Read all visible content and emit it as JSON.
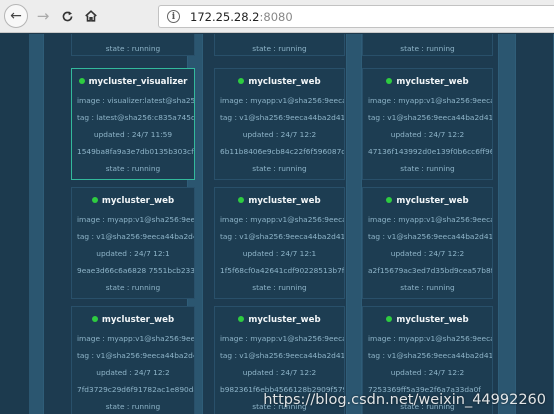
{
  "browser": {
    "url_host": "172.25.28.2",
    "url_port": ":8080",
    "back_icon": "arrow-left-icon",
    "forward_icon": "arrow-right-icon",
    "reload_icon": "reload-icon",
    "home_icon": "home-icon",
    "info_glyph": "i"
  },
  "top_partial": [
    {
      "text": "state : running"
    },
    {
      "text": "state : running"
    },
    {
      "text": "state : running"
    }
  ],
  "rows": [
    [
      {
        "name": "mycluster_visualizer",
        "image": "image : visualizer:latest@sha256:c",
        "tag": "tag : latest@sha256:c835a745d99e",
        "updated": "updated : 24/7 11:59",
        "id": "1549ba8fa9a3e7db0135b303cf96a",
        "state": "state : running"
      },
      {
        "name": "mycluster_web",
        "image": "image : myapp:v1@sha256:9eeca4e",
        "tag": "tag : v1@sha256:9eeca44ba2d410e",
        "updated": "updated : 24/7 12:2",
        "id": "6b11b8406e9cb84c22f6f596087ca",
        "state": "state : running"
      },
      {
        "name": "mycluster_web",
        "image": "image : myapp:v1@sha256:9eeca4e",
        "tag": "tag : v1@sha256:9eeca44ba2d410e",
        "updated": "updated : 24/7 12:2",
        "id": "47136f143992d0e139f0b6cc6ff961",
        "state": "state : running"
      }
    ],
    [
      {
        "name": "mycluster_web",
        "image": "image : myapp:v1@sha256:9eeca4e",
        "tag": "tag : v1@sha256:9eeca44ba2d410e",
        "updated": "updated : 24/7 12:1",
        "id": "9eae3d66c6a6828 7551bcb2337ebf",
        "state": "state : running"
      },
      {
        "name": "mycluster_web",
        "image": "image : myapp:v1@sha256:9eeca4e",
        "tag": "tag : v1@sha256:9eeca44ba2d410e",
        "updated": "updated : 24/7 12:1",
        "id": "1f5f68cf0a42641cdf90228513b7fcec",
        "state": "state : running"
      },
      {
        "name": "mycluster_web",
        "image": "image : myapp:v1@sha256:9eeca4e",
        "tag": "tag : v1@sha256:9eeca44ba2d410e",
        "updated": "updated : 24/7 12:2",
        "id": "a2f15679ac3ed7d35bd9cea57b8f84",
        "state": "state : running"
      }
    ],
    [
      {
        "name": "mycluster_web",
        "image": "image : myapp:v1@sha256:9eeca4e",
        "tag": "tag : v1@sha256:9eeca44ba2d410e",
        "updated": "updated : 24/7 12:2",
        "id": "7fd3729c29d6f91782ac1e890da73",
        "state": "state : running"
      },
      {
        "name": "mycluster_web",
        "image": "image : myapp:v1@sha256:9eeca4e",
        "tag": "tag : v1@sha256:9eeca44ba2d410e",
        "updated": "updated : 24/7 12:2",
        "id": "b982361f6ebb4566128b2909f579f",
        "state": "state : running"
      },
      {
        "name": "mycluster_web",
        "image": "image : myapp:v1@sha256:9eeca4e",
        "tag": "tag : v1@sha256:9eeca44ba2d410e",
        "updated": "updated : 24/7 12:2",
        "id": "7253369ff5a39e2f6a7a33da0f",
        "state": "state : running"
      }
    ]
  ],
  "watermark": "https://blog.csdn.net/weixin_44992260",
  "colors": {
    "running_dot": "#2ecc40",
    "active_border": "#33b99c"
  }
}
